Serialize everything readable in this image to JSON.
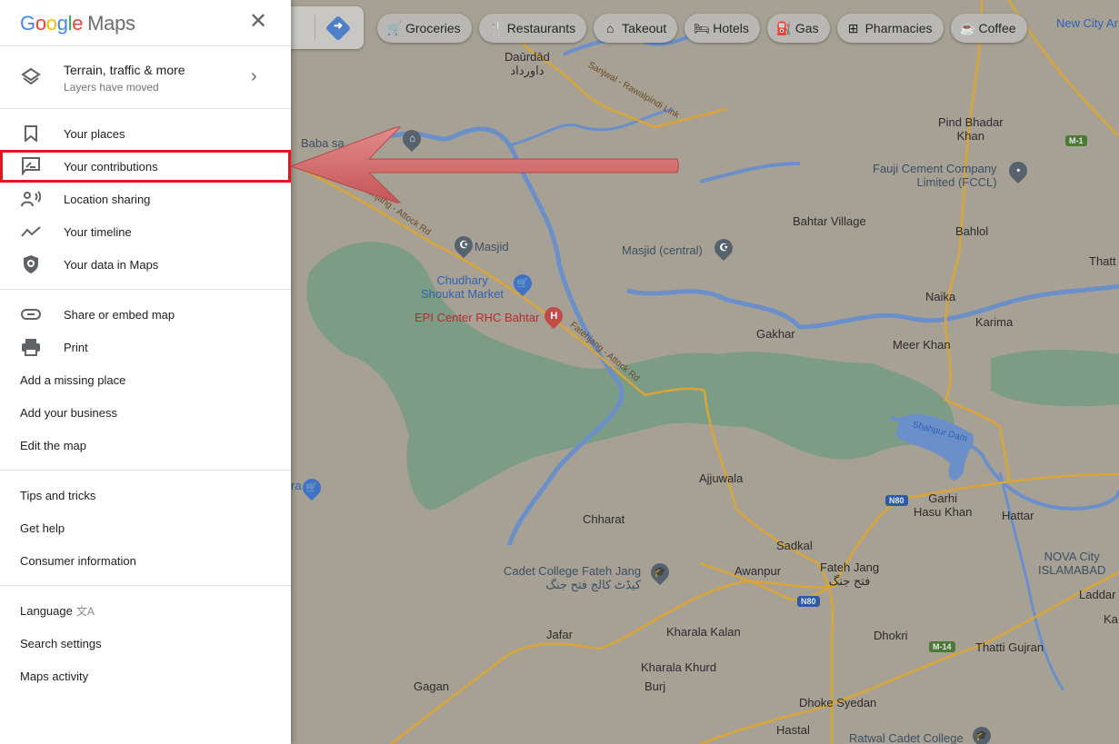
{
  "sidebar": {
    "logo": {
      "g": "G",
      "o1": "o",
      "o2": "o",
      "g2": "g",
      "l": "l",
      "e": "e",
      "maps": "Maps"
    },
    "close_icon": "close-icon",
    "layers": {
      "title": "Terrain, traffic & more",
      "subtitle": "Layers have moved",
      "icon": "layers-icon"
    },
    "section1": [
      {
        "label": "Your places",
        "icon": "bookmark-icon"
      },
      {
        "label": "Your contributions",
        "icon": "contributions-icon",
        "highlighted": true
      },
      {
        "label": "Location sharing",
        "icon": "location-sharing-icon"
      },
      {
        "label": "Your timeline",
        "icon": "timeline-icon"
      },
      {
        "label": "Your data in Maps",
        "icon": "shield-icon"
      }
    ],
    "section2": [
      {
        "label": "Share or embed map",
        "icon": "link-icon"
      },
      {
        "label": "Print",
        "icon": "print-icon"
      },
      {
        "label": "Add a missing place"
      },
      {
        "label": "Add your business"
      },
      {
        "label": "Edit the map"
      }
    ],
    "section3": [
      {
        "label": "Tips and tricks"
      },
      {
        "label": "Get help"
      },
      {
        "label": "Consumer information"
      }
    ],
    "section4": [
      {
        "label": "Language",
        "icon": "translate-icon"
      },
      {
        "label": "Search settings"
      },
      {
        "label": "Maps activity"
      }
    ]
  },
  "chips": [
    {
      "label": "Groceries",
      "icon": "cart-icon",
      "glyph": "🛒"
    },
    {
      "label": "Restaurants",
      "icon": "fork-knife-icon",
      "glyph": "🍴"
    },
    {
      "label": "Takeout",
      "icon": "takeout-icon",
      "glyph": "⌂"
    },
    {
      "label": "Hotels",
      "icon": "bed-icon",
      "glyph": "🛏"
    },
    {
      "label": "Gas",
      "icon": "gas-pump-icon",
      "glyph": "⛽"
    },
    {
      "label": "Pharmacies",
      "icon": "pharmacy-icon",
      "glyph": "⊞"
    },
    {
      "label": "Coffee",
      "icon": "coffee-icon",
      "glyph": "☕"
    }
  ],
  "search": {
    "search_icon": "⌕",
    "directions_icon": "➜"
  },
  "map": {
    "places": [
      {
        "name": "Daūrdād",
        "sub": "داورداد"
      },
      {
        "name": "Pind Bhadar",
        "sub": "Khan"
      },
      {
        "name": "Fauji Cement Company",
        "sub": "Limited (FCCL)"
      },
      {
        "name": "Baba sa... ...or"
      },
      {
        "name": "Bahtar Village"
      },
      {
        "name": "Bahlol"
      },
      {
        "name": "Thatt"
      },
      {
        "name": "Masjid"
      },
      {
        "name": "Masjid (central)"
      },
      {
        "name": "Chudhary",
        "sub": "Shoukat Market"
      },
      {
        "name": "EPI Center RHC Bahtar"
      },
      {
        "name": "Naika"
      },
      {
        "name": "Karima"
      },
      {
        "name": "Gakhar"
      },
      {
        "name": "Meer Khan"
      },
      {
        "name": "Shahpur Dam"
      },
      {
        "name": "Ajjuwala"
      },
      {
        "name": "Garhi",
        "sub": "Hasu Khan"
      },
      {
        "name": "Hattar"
      },
      {
        "name": "Chharat"
      },
      {
        "name": "Sadkal"
      },
      {
        "name": "NOVA City",
        "sub": "ISLAMABAD"
      },
      {
        "name": "Cadet College Fateh Jang",
        "sub": "کیڈٹ کالج فتح جنگ"
      },
      {
        "name": "Awanpur"
      },
      {
        "name": "Fateh Jang",
        "sub": "فتح جنگ"
      },
      {
        "name": "Laddar"
      },
      {
        "name": "Ka"
      },
      {
        "name": "Jafar"
      },
      {
        "name": "Kharala Kalan"
      },
      {
        "name": "Dhokri"
      },
      {
        "name": "Thatti Gujran"
      },
      {
        "name": "Kharala Khurd"
      },
      {
        "name": "Burj"
      },
      {
        "name": "Gagan"
      },
      {
        "name": "Dhoke Syedan"
      },
      {
        "name": "Hastal"
      },
      {
        "name": "Ratwal Cadet College"
      },
      {
        "name": "New City Ar"
      },
      {
        "name": "ra"
      }
    ],
    "roads": {
      "r1": "Sanjwal - Rawalpindi Link",
      "r2": "Fatehjang - Attock Rd",
      "r3": "Fatehjang - Attock Rd"
    },
    "shields": {
      "n80a": "N80",
      "n80b": "N80",
      "m1": "M-1",
      "m14": "M-14"
    }
  },
  "colors": {
    "highlight_box": "#e0171f",
    "arrow": "#d9686a",
    "map_bg": "#a6a194",
    "forest": "#7d9c86",
    "water": "#6b8fc9",
    "road": "#d9a537"
  }
}
